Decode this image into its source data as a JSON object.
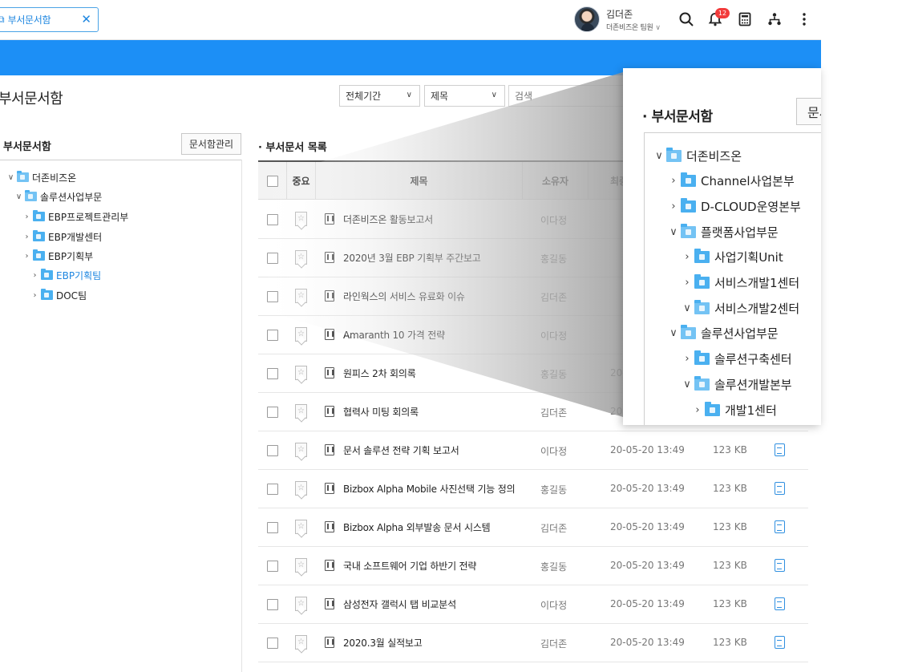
{
  "header": {
    "tab_label": "부서문서함",
    "tab_close": "✕",
    "user_name": "김더존",
    "user_org": "더존비즈온 팀원",
    "notification_count": "12"
  },
  "page": {
    "title": "부서문서함",
    "filters": {
      "period": "전체기간",
      "field": "제목",
      "search_placeholder": "검색"
    }
  },
  "left": {
    "heading": "부서문서함",
    "manage_button": "문서함관리",
    "tree": [
      {
        "label": "더존비즈온",
        "toggle": "∨"
      },
      {
        "label": "솔루션사업부문",
        "toggle": "∨"
      },
      {
        "label": "EBP프로젝트관리부",
        "toggle": "›"
      },
      {
        "label": "EBP개발센터",
        "toggle": "›"
      },
      {
        "label": "EBP기획부",
        "toggle": "›"
      },
      {
        "label": "EBP기획팀",
        "toggle": "›"
      },
      {
        "label": "DOC팀",
        "toggle": "›"
      }
    ]
  },
  "list": {
    "heading": "부서문서 목록",
    "columns": {
      "important": "중요",
      "title": "제목",
      "owner": "소유자",
      "date": "최종"
    },
    "rows": [
      {
        "title": "더존비즈온 활동보고서",
        "owner": "이다정",
        "date": "",
        "size": ""
      },
      {
        "title": "2020년 3월 EBP 기획부 주간보고",
        "owner": "홍길동",
        "date": "",
        "size": ""
      },
      {
        "title": "라인웍스의 서비스 유료화 이슈",
        "owner": "김더존",
        "date": "",
        "size": ""
      },
      {
        "title": "Amaranth 10 가격 전략",
        "owner": "이다정",
        "date": "",
        "size": ""
      },
      {
        "title": "원피스 2차 회의록",
        "owner": "홍길동",
        "date": "20-",
        "size": ""
      },
      {
        "title": "협력사 미팅 회의록",
        "owner": "김더존",
        "date": "20",
        "size": ""
      },
      {
        "title": "문서 솔루션 전략 기획 보고서",
        "owner": "이다정",
        "date": "20-05-20 13:49",
        "size": "123 KB"
      },
      {
        "title": "Bizbox Alpha Mobile 사진선택 기능 정의",
        "owner": "홍길동",
        "date": "20-05-20 13:49",
        "size": "123 KB"
      },
      {
        "title": "Bizbox Alpha 외부발송 문서 시스템",
        "owner": "김더존",
        "date": "20-05-20 13:49",
        "size": "123 KB"
      },
      {
        "title": "국내 소프트웨어 기업 하반기 전략",
        "owner": "홍길동",
        "date": "20-05-20 13:49",
        "size": "123 KB"
      },
      {
        "title": "삼성전자 갤럭시 탭 비교분석",
        "owner": "이다정",
        "date": "20-05-20 13:49",
        "size": "123 KB"
      },
      {
        "title": "2020.3월 실적보고",
        "owner": "김더존",
        "date": "20-05-20 13:49",
        "size": "123 KB"
      }
    ]
  },
  "zoom": {
    "heading": "부서문서함",
    "manage_button": "문서함관리",
    "tree": [
      {
        "label": "더존비즈온",
        "toggle": "∨"
      },
      {
        "label": "Channel사업본부",
        "toggle": "›"
      },
      {
        "label": "D-CLOUD운영본부",
        "toggle": "›"
      },
      {
        "label": "플랫폼사업부문",
        "toggle": "∨"
      },
      {
        "label": "사업기획Unit",
        "toggle": "›"
      },
      {
        "label": "서비스개발1센터",
        "toggle": "›"
      },
      {
        "label": "서비스개발2센터",
        "toggle": "∨"
      },
      {
        "label": "솔루션사업부문",
        "toggle": "∨"
      },
      {
        "label": "솔루션구축센터",
        "toggle": "›"
      },
      {
        "label": "솔루션개발본부",
        "toggle": "∨"
      },
      {
        "label": "개발1센터",
        "toggle": "›"
      }
    ]
  },
  "colors": {
    "brand_blue": "#1c8ff6",
    "link_blue": "#1d86e0",
    "badge_red": "#f23b3b"
  }
}
